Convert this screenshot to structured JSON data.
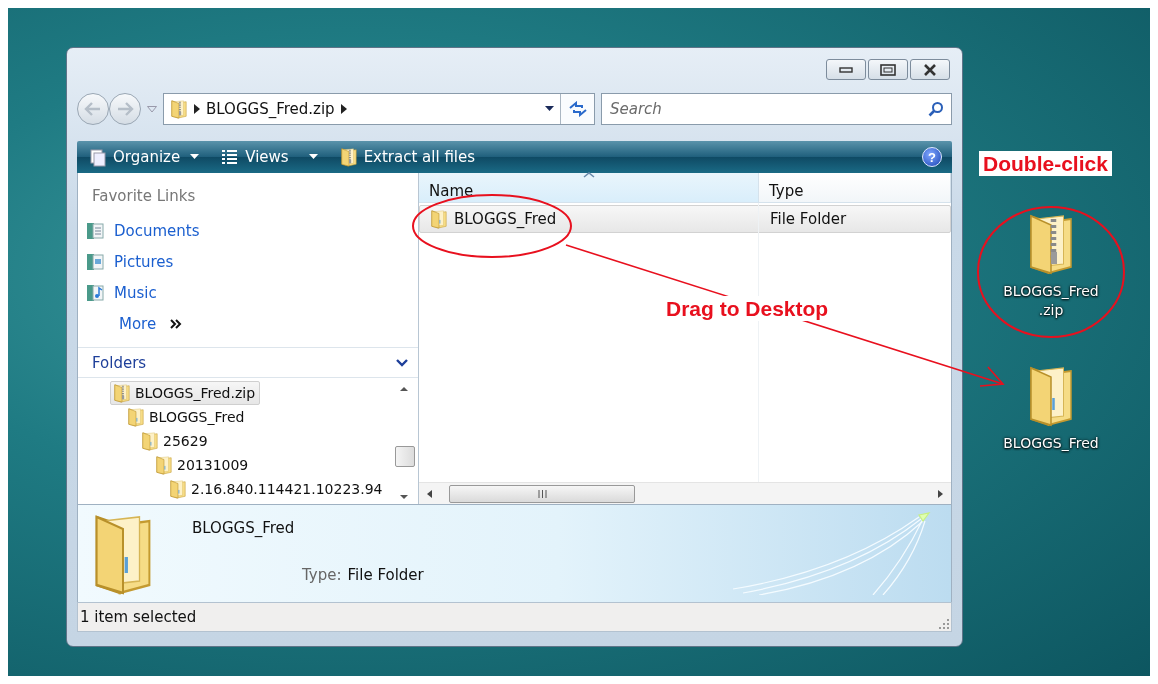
{
  "address_bar": {
    "path": [
      "BLOGGS_Fred.zip"
    ]
  },
  "search": {
    "placeholder": "Search"
  },
  "toolbar": {
    "items": [
      {
        "label": "Organize",
        "kind": "menu"
      },
      {
        "label": "Views",
        "kind": "menu"
      },
      {
        "label": "Extract all files",
        "kind": "extract"
      }
    ],
    "help": "?"
  },
  "favorite_links": {
    "title": "Favorite Links",
    "items": [
      {
        "label": "Documents",
        "kind": "documents"
      },
      {
        "label": "Pictures",
        "kind": "pictures"
      },
      {
        "label": "Music",
        "kind": "music"
      },
      {
        "label": "More",
        "kind": "more"
      }
    ]
  },
  "folders": {
    "title": "Folders",
    "tree": [
      {
        "label": "BLOGGS_Fred.zip",
        "kind": "zip",
        "selected": true,
        "children": [
          {
            "label": "BLOGGS_Fred",
            "kind": "folder",
            "selected": false,
            "children": [
              {
                "label": "25629",
                "kind": "folder",
                "selected": false,
                "children": [
                  {
                    "label": "20131009",
                    "kind": "folder",
                    "selected": false,
                    "children": [
                      {
                        "label": "2.16.840.114421.10223.94",
                        "kind": "folder",
                        "selected": false
                      }
                    ]
                  }
                ]
              }
            ]
          }
        ]
      }
    ]
  },
  "file_list": {
    "columns": [
      {
        "label": "Name",
        "sorted": true
      },
      {
        "label": "Type",
        "sorted": false
      }
    ],
    "rows": [
      {
        "name": "BLOGGS_Fred",
        "type": "File Folder",
        "selected": true
      }
    ]
  },
  "details_pane": {
    "name": "BLOGGS_Fred",
    "type_label": "Type:",
    "type_value": "File Folder"
  },
  "status_bar": {
    "text": "1 item selected"
  },
  "desktop_icons": [
    {
      "label_lines": [
        "BLOGGS_Fred",
        ".zip"
      ],
      "kind": "zip"
    },
    {
      "label_lines": [
        "BLOGGS_Fred"
      ],
      "kind": "folder"
    }
  ],
  "annotations": [
    {
      "text": "Double-click",
      "kind": "double-click"
    },
    {
      "text": "Drag to Desktop",
      "kind": "drag"
    }
  ]
}
